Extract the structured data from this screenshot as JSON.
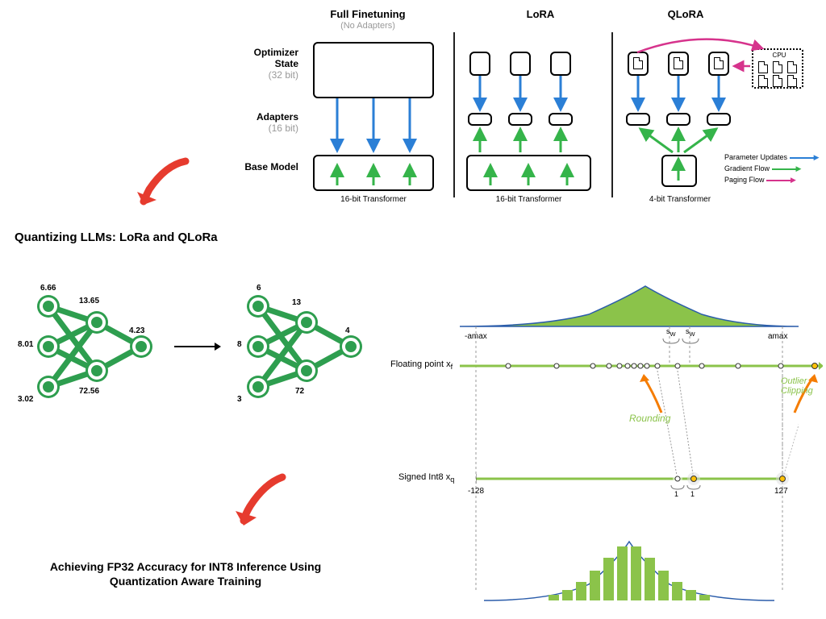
{
  "top": {
    "columns": [
      {
        "title": "Full Finetuning",
        "subtitle": "(No Adapters)",
        "caption": "16-bit Transformer"
      },
      {
        "title": "LoRA",
        "subtitle": "",
        "caption": "16-bit Transformer"
      },
      {
        "title": "QLoRA",
        "subtitle": "",
        "caption": "4-bit Transformer"
      }
    ],
    "rows": [
      {
        "label": "Optimizer State",
        "sub": "(32 bit)"
      },
      {
        "label": "Adapters",
        "sub": "(16 bit)"
      },
      {
        "label": "Base Model",
        "sub": ""
      }
    ],
    "cpu": "CPU",
    "legend": [
      {
        "label": "Parameter Updates",
        "color": "#2b7fd6"
      },
      {
        "label": "Gradient Flow",
        "color": "#35b44a"
      },
      {
        "label": "Paging Flow",
        "color": "#d6338c"
      }
    ]
  },
  "sect1": "Quantizing LLMs: LoRa and QLoRa",
  "sect2": "Achieving FP32 Accuracy for INT8 Inference Using Quantization Aware Training",
  "nn": {
    "left_values": [
      "6.66",
      "13.65",
      "8.01",
      "4.23",
      "3.02",
      "72.56"
    ],
    "right_values": [
      "6",
      "13",
      "8",
      "4",
      "3",
      "72"
    ]
  },
  "quant": {
    "amax_neg": "-amax",
    "amax_pos": "amax",
    "sw": "s",
    "sw_sub": "W",
    "fp_label": "Floating point x",
    "fp_sub": "f",
    "int_label": "Signed Int8 x",
    "int_sub": "q",
    "int_min": "-128",
    "int_max": "127",
    "tick1": "1",
    "tick2": "1",
    "rounding": "Rounding",
    "clipping": "Outlier Clipping"
  }
}
